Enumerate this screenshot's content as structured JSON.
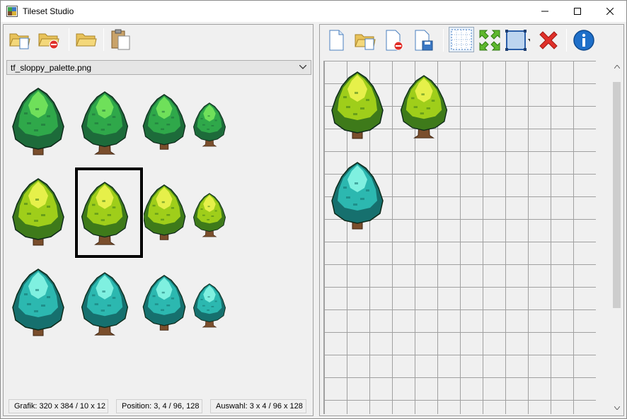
{
  "window": {
    "title": "Tileset Studio",
    "controls": [
      "minimize",
      "maximize",
      "close"
    ]
  },
  "left_toolbar": [
    "open-tileset-icon",
    "close-tileset-icon",
    "open-folder-icon",
    "paste-icon"
  ],
  "tileset": {
    "selected_file": "tf_sloppy_palette.png"
  },
  "statusbar": {
    "grafik": "Grafik: 320 x 384 / 10 x 12",
    "position": "Position: 3, 4 / 96, 128",
    "auswahl": "Auswahl: 3 x 4 / 96 x 128"
  },
  "right_toolbar": [
    "new-map-icon",
    "open-map-icon",
    "close-map-icon",
    "save-map-icon",
    "grid-toggle-icon",
    "fit-icon",
    "resize-canvas-icon",
    "delete-icon",
    "info-icon"
  ],
  "colors": {
    "green_leaf": "#2fa84a",
    "yellow_leaf": "#9fce1a",
    "teal_leaf": "#2cb8b0",
    "trunk": "#7a4e2c",
    "info_blue": "#1e6fc9",
    "delete_red": "#e0302a"
  }
}
